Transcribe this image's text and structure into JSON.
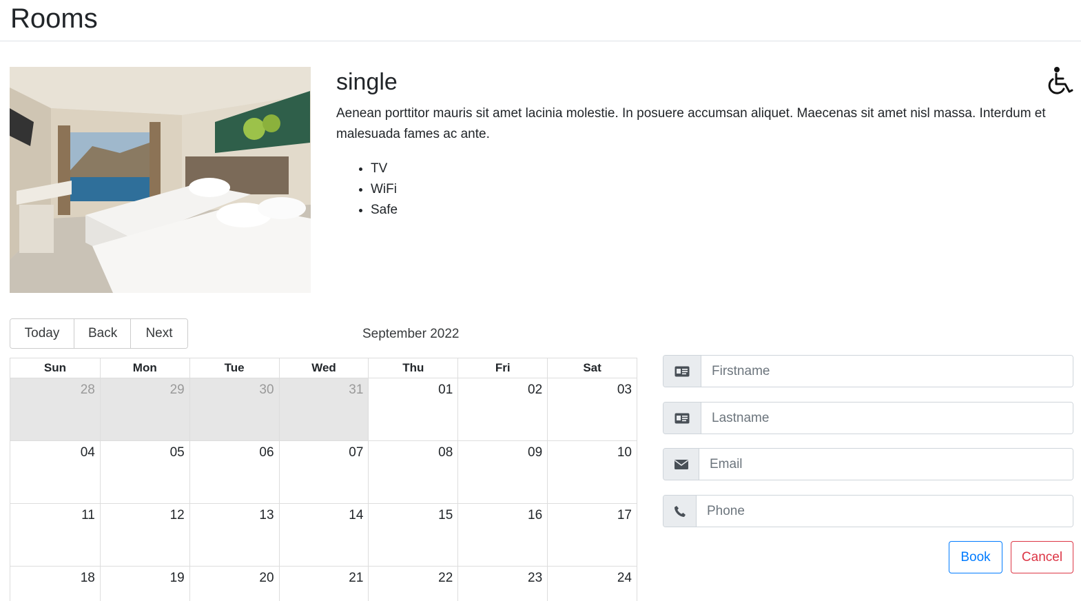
{
  "page": {
    "title": "Rooms"
  },
  "room": {
    "type": "single",
    "description": "Aenean porttitor mauris sit amet lacinia molestie. In posuere accumsan aliquet. Maecenas sit amet nisl massa. Interdum et malesuada fames ac ante.",
    "features": [
      "TV",
      "WiFi",
      "Safe"
    ],
    "accessible_icon": "wheelchair-icon",
    "photo_icon": "hotel-room-photo"
  },
  "calendar": {
    "toolbar": {
      "today": "Today",
      "back": "Back",
      "next": "Next"
    },
    "month_label": "September 2022",
    "weekdays": [
      "Sun",
      "Mon",
      "Tue",
      "Wed",
      "Thu",
      "Fri",
      "Sat"
    ],
    "weeks": [
      [
        {
          "day": "28",
          "off": true
        },
        {
          "day": "29",
          "off": true
        },
        {
          "day": "30",
          "off": true
        },
        {
          "day": "31",
          "off": true
        },
        {
          "day": "01",
          "off": false
        },
        {
          "day": "02",
          "off": false
        },
        {
          "day": "03",
          "off": false
        }
      ],
      [
        {
          "day": "04",
          "off": false
        },
        {
          "day": "05",
          "off": false
        },
        {
          "day": "06",
          "off": false
        },
        {
          "day": "07",
          "off": false
        },
        {
          "day": "08",
          "off": false
        },
        {
          "day": "09",
          "off": false
        },
        {
          "day": "10",
          "off": false
        }
      ],
      [
        {
          "day": "11",
          "off": false
        },
        {
          "day": "12",
          "off": false
        },
        {
          "day": "13",
          "off": false
        },
        {
          "day": "14",
          "off": false
        },
        {
          "day": "15",
          "off": false
        },
        {
          "day": "16",
          "off": false
        },
        {
          "day": "17",
          "off": false
        }
      ],
      [
        {
          "day": "18",
          "off": false
        },
        {
          "day": "19",
          "off": false
        },
        {
          "day": "20",
          "off": false
        },
        {
          "day": "21",
          "off": false
        },
        {
          "day": "22",
          "off": false
        },
        {
          "day": "23",
          "off": false
        },
        {
          "day": "24",
          "off": false
        }
      ]
    ]
  },
  "form": {
    "firstname": {
      "placeholder": "Firstname",
      "value": "",
      "icon": "id-card-icon"
    },
    "lastname": {
      "placeholder": "Lastname",
      "value": "",
      "icon": "id-card-icon"
    },
    "email": {
      "placeholder": "Email",
      "value": "",
      "icon": "envelope-icon"
    },
    "phone": {
      "placeholder": "Phone",
      "value": "",
      "icon": "phone-icon"
    },
    "book_label": "Book",
    "cancel_label": "Cancel"
  },
  "colors": {
    "primary": "#007bff",
    "danger": "#dc3545",
    "off_day_bg": "#e6e6e6",
    "addon_bg": "#e9ecef"
  }
}
